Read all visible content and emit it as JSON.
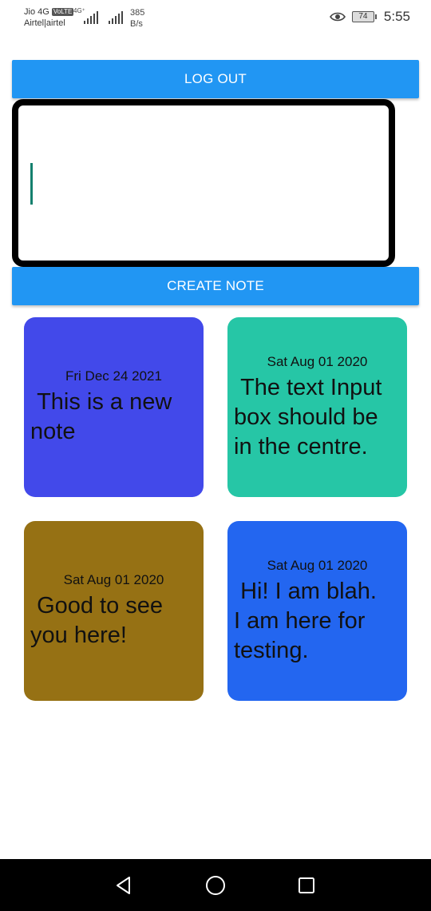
{
  "status_bar": {
    "carrier_line1": "Jio 4G",
    "carrier_badge": "VoLTE",
    "carrier_line2": "Airtel|airtel",
    "network_type": "4G⁺",
    "speed_value": "385",
    "speed_unit": "B/s",
    "battery_level": "74",
    "time": "5:55",
    "icons": [
      "signal-icon",
      "eye-icon",
      "battery-icon"
    ]
  },
  "logout_button": {
    "label": "LOG OUT"
  },
  "note_input": {
    "value": "",
    "placeholder": ""
  },
  "create_button": {
    "label": "CREATE NOTE"
  },
  "notes": [
    {
      "date": "Fri Dec 24 2021",
      "text": " This is a new\nnote",
      "color": "#4249EA"
    },
    {
      "date": "Sat Aug 01 2020",
      "text": " The text Input\nbox should be\nin the centre.",
      "color": "#26C6A6"
    },
    {
      "date": "Sat Aug 01 2020",
      "text": " Good to see\nyou here!",
      "color": "#967114"
    },
    {
      "date": "Sat Aug 01 2020",
      "text": " Hi! I am blah.\nI am here for\ntesting.",
      "color": "#2366F0"
    }
  ],
  "nav_bar": {
    "icons": [
      "back-icon",
      "home-icon",
      "recents-icon"
    ]
  },
  "colors": {
    "accent": "#2196F3",
    "caret": "#14806e"
  }
}
